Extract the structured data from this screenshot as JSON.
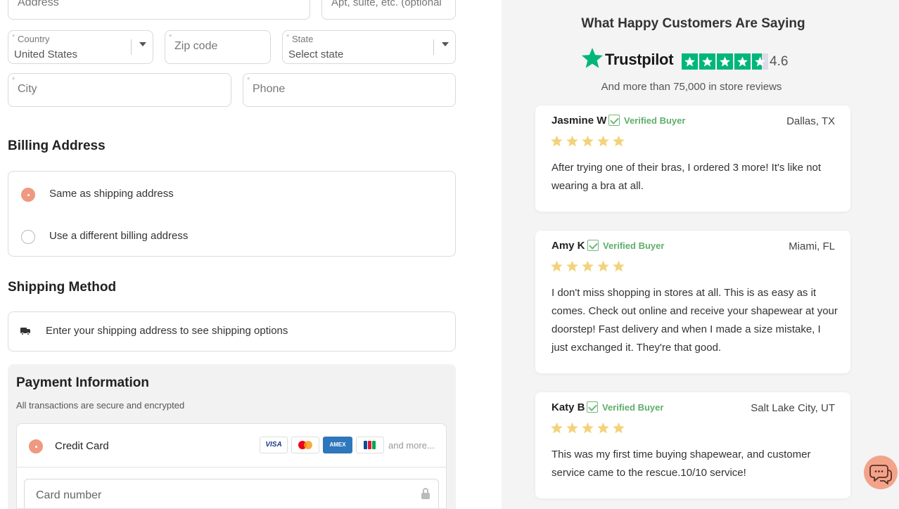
{
  "shipping_form": {
    "address_placeholder": "Address",
    "apt_placeholder": "Apt, suite, etc. (optional",
    "country_label": "Country",
    "country_value": "United States",
    "zip_placeholder": "Zip code",
    "state_label": "State",
    "state_value": "Select state",
    "city_placeholder": "City",
    "phone_placeholder": "Phone",
    "required_mark": "*"
  },
  "billing": {
    "title": "Billing Address",
    "options": [
      {
        "label": "Same as shipping address",
        "selected": true
      },
      {
        "label": "Use a different billing address",
        "selected": false
      }
    ]
  },
  "shipping_method": {
    "title": "Shipping Method",
    "message": "Enter your shipping address to see shipping options"
  },
  "payment": {
    "title": "Payment Information",
    "subtitle": "All transactions are secure and encrypted",
    "method_label": "Credit Card",
    "cards": [
      "VISA",
      "mastercard",
      "AMEX",
      "JCB"
    ],
    "more_label": "and more...",
    "card_number_placeholder": "Card number"
  },
  "reviews_panel": {
    "title": "What Happy Customers Are Saying",
    "trustpilot_name": "Trustpilot",
    "rating": "4.6",
    "rating_value": 4.6,
    "subtitle": "And more than 75,000 in store reviews",
    "verified_label": "Verified Buyer",
    "reviews": [
      {
        "name": "Jasmine W",
        "location": "Dallas, TX",
        "stars": 5,
        "text": "After trying one of their bras, I ordered 3 more! It's like not wearing a bra at all."
      },
      {
        "name": "Amy K",
        "location": "Miami, FL",
        "stars": 5,
        "text": "I don't miss shopping in stores at all. This is as easy as it comes. Check out online and receive your shapewear at your doorstep! Fast delivery and when I made a size mistake, I just exchanged it. They're that good."
      },
      {
        "name": "Katy B",
        "location": "Salt Lake City, UT",
        "stars": 5,
        "text": "This was my first time buying shapewear, and customer service came to the rescue.10/10 service!"
      }
    ]
  },
  "colors": {
    "accent": "#ee9980",
    "trustpilot_green": "#00b67a",
    "star_gold": "#f2d37a",
    "verified_green": "#5fae6a"
  },
  "icons": {
    "chat": "chat-bubble-icon",
    "truck": "truck-icon",
    "lock": "lock-icon"
  }
}
